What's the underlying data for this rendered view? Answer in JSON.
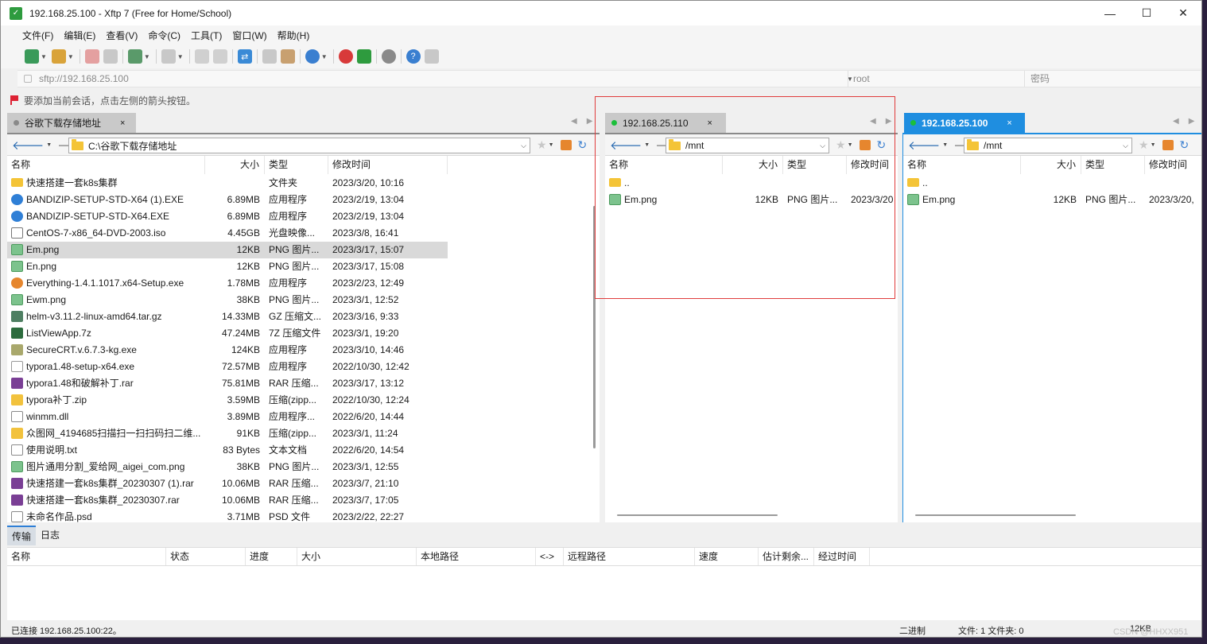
{
  "window": {
    "title": "192.168.25.100 - Xftp 7 (Free for Home/School)",
    "app_icon": "Xftp",
    "buttons": {
      "minimize": "—",
      "maximize": "☐",
      "close": "✕"
    }
  },
  "menu": [
    "文件(F)",
    "编辑(E)",
    "查看(V)",
    "命令(C)",
    "工具(T)",
    "窗口(W)",
    "帮助(H)"
  ],
  "address": {
    "url": "sftp://192.168.25.100",
    "user": "root",
    "password": "密码"
  },
  "hint": "要添加当前会话，点击左侧的箭头按钮。",
  "left_pane": {
    "tab": "谷歌下载存储地址",
    "path": "C:\\谷歌下载存储地址",
    "columns": [
      "名称",
      "大小",
      "类型",
      "修改时间"
    ],
    "files": [
      {
        "icon": "folder",
        "name": "快速搭建一套k8s集群",
        "size": "",
        "type": "文件夹",
        "mtime": "2023/3/20, 10:16"
      },
      {
        "icon": "exe",
        "name": "BANDIZIP-SETUP-STD-X64 (1).EXE",
        "size": "6.89MB",
        "type": "应用程序",
        "mtime": "2023/2/19, 13:04"
      },
      {
        "icon": "exe",
        "name": "BANDIZIP-SETUP-STD-X64.EXE",
        "size": "6.89MB",
        "type": "应用程序",
        "mtime": "2023/2/19, 13:04"
      },
      {
        "icon": "iso",
        "name": "CentOS-7-x86_64-DVD-2003.iso",
        "size": "4.45GB",
        "type": "光盘映像...",
        "mtime": "2023/3/8, 16:41"
      },
      {
        "icon": "png",
        "name": "Em.png",
        "size": "12KB",
        "type": "PNG 图片...",
        "mtime": "2023/3/17, 15:07",
        "selected": true
      },
      {
        "icon": "png",
        "name": "En.png",
        "size": "12KB",
        "type": "PNG 图片...",
        "mtime": "2023/3/17, 15:08"
      },
      {
        "icon": "search",
        "name": "Everything-1.4.1.1017.x64-Setup.exe",
        "size": "1.78MB",
        "type": "应用程序",
        "mtime": "2023/2/23, 12:49"
      },
      {
        "icon": "png",
        "name": "Ewm.png",
        "size": "38KB",
        "type": "PNG 图片...",
        "mtime": "2023/3/1, 12:52"
      },
      {
        "icon": "gz",
        "name": "helm-v3.11.2-linux-amd64.tar.gz",
        "size": "14.33MB",
        "type": "GZ 压缩文...",
        "mtime": "2023/3/16, 9:33"
      },
      {
        "icon": "z7",
        "name": "ListViewApp.7z",
        "size": "47.24MB",
        "type": "7Z 压缩文件",
        "mtime": "2023/3/1, 19:20"
      },
      {
        "icon": "crt",
        "name": "SecureCRT.v.6.7.3-kg.exe",
        "size": "124KB",
        "type": "应用程序",
        "mtime": "2023/3/10, 14:46"
      },
      {
        "icon": "ty",
        "name": "typora1.48-setup-x64.exe",
        "size": "72.57MB",
        "type": "应用程序",
        "mtime": "2022/10/30, 12:42"
      },
      {
        "icon": "rar",
        "name": "typora1.48和破解补丁.rar",
        "size": "75.81MB",
        "type": "RAR 压缩...",
        "mtime": "2023/3/17, 13:12"
      },
      {
        "icon": "zip",
        "name": "typora补丁.zip",
        "size": "3.59MB",
        "type": "压缩(zipp...",
        "mtime": "2022/10/30, 12:24"
      },
      {
        "icon": "dll",
        "name": "winmm.dll",
        "size": "3.89MB",
        "type": "应用程序...",
        "mtime": "2022/6/20, 14:44"
      },
      {
        "icon": "zip",
        "name": "众图网_4194685扫描扫一扫扫码扫二维...",
        "size": "91KB",
        "type": "压缩(zipp...",
        "mtime": "2023/3/1, 11:24"
      },
      {
        "icon": "txt",
        "name": "使用说明.txt",
        "size": "83 Bytes",
        "type": "文本文档",
        "mtime": "2022/6/20, 14:54"
      },
      {
        "icon": "png",
        "name": "图片通用分割_爱给网_aigei_com.png",
        "size": "38KB",
        "type": "PNG 图片...",
        "mtime": "2023/3/1, 12:55"
      },
      {
        "icon": "rar",
        "name": "快速搭建一套k8s集群_20230307 (1).rar",
        "size": "10.06MB",
        "type": "RAR 压缩...",
        "mtime": "2023/3/7, 21:10"
      },
      {
        "icon": "rar",
        "name": "快速搭建一套k8s集群_20230307.rar",
        "size": "10.06MB",
        "type": "RAR 压缩...",
        "mtime": "2023/3/7, 17:05"
      },
      {
        "icon": "psd",
        "name": "未命名作品.psd",
        "size": "3.71MB",
        "type": "PSD 文件",
        "mtime": "2023/2/22, 22:27"
      }
    ]
  },
  "middle_pane": {
    "tab": "192.168.25.110",
    "path": "/mnt",
    "columns": [
      "名称",
      "大小",
      "类型",
      "修改时间"
    ],
    "files": [
      {
        "icon": "folder",
        "name": "..",
        "size": "",
        "type": "",
        "mtime": ""
      },
      {
        "icon": "png",
        "name": "Em.png",
        "size": "12KB",
        "type": "PNG 图片...",
        "mtime": "2023/3/20"
      }
    ]
  },
  "right_pane": {
    "tab": "192.168.25.100",
    "path": "/mnt",
    "columns": [
      "名称",
      "大小",
      "类型",
      "修改时间"
    ],
    "files": [
      {
        "icon": "folder",
        "name": "..",
        "size": "",
        "type": "",
        "mtime": ""
      },
      {
        "icon": "png",
        "name": "Em.png",
        "size": "12KB",
        "type": "PNG 图片...",
        "mtime": "2023/3/20,"
      }
    ]
  },
  "transfer": {
    "tabs": [
      "传输",
      "日志"
    ],
    "columns": [
      "名称",
      "状态",
      "进度",
      "大小",
      "本地路径",
      "<->",
      "远程路径",
      "速度",
      "估计剩余...",
      "经过时间"
    ]
  },
  "status": {
    "connection": "已连接 192.168.25.100:22。",
    "mode": "二进制",
    "files": "文件: 1  文件夹: 0",
    "size": "12KB"
  },
  "watermark": "CSDN @HHXX951",
  "colors": {
    "accent": "#2f7fd6",
    "connected_dot": "#1bbf3a",
    "annotation_box": "#e03c3c"
  }
}
